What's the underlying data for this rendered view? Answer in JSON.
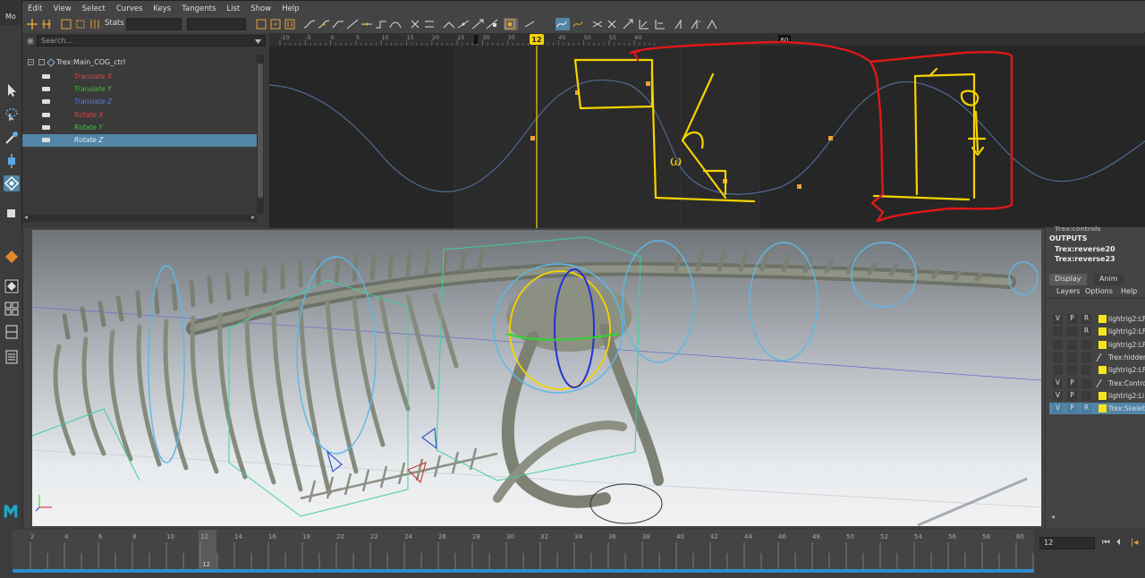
{
  "app": {
    "menu_partial": "Mo"
  },
  "graph_editor": {
    "menu": [
      "Edit",
      "View",
      "Select",
      "Curves",
      "Keys",
      "Tangents",
      "List",
      "Show",
      "Help"
    ],
    "stats_label": "Stats",
    "search_placeholder": "Search...",
    "ruler_ticks": [
      "-10",
      "-5",
      "0",
      "5",
      "10",
      "15",
      "20",
      "25",
      "30",
      "35",
      "40",
      "45",
      "50",
      "55",
      "60"
    ],
    "current_frame": "12",
    "ruler_end_label": "60",
    "outliner": {
      "root": "Trex:Main_COG_ctrl",
      "channels": [
        {
          "label": "Translate X",
          "color": "#e04444"
        },
        {
          "label": "Translate Y",
          "color": "#3fbf3f"
        },
        {
          "label": "Translate Z",
          "color": "#5a7be0"
        },
        {
          "label": "Rotate X",
          "color": "#e04444"
        },
        {
          "label": "Rotate Y",
          "color": "#3fbf3f"
        },
        {
          "label": "Rotate Z",
          "color": "#7d9fe6",
          "selected": true
        }
      ]
    },
    "annotation_text": "ω"
  },
  "channel_box": {
    "truncated_header": "Trex:controls",
    "outputs_label": "OUTPUTS",
    "outputs": [
      "Trex:reverse20",
      "Trex:reverse23"
    ],
    "tabs": [
      "Display",
      "Anim"
    ],
    "submenu": [
      "Layers",
      "Options",
      "Help"
    ],
    "layers": [
      {
        "v": "V",
        "p": "P",
        "r": "R",
        "name": "lightrig2:LF",
        "swatch": true
      },
      {
        "v": "",
        "p": "",
        "r": "R",
        "name": "lightrig2:LF",
        "swatch": true
      },
      {
        "v": "",
        "p": "",
        "r": "",
        "name": "lightrig2:LF",
        "swatch": true
      },
      {
        "v": "",
        "p": "",
        "r": "",
        "name": "Trex:hidden",
        "swatch": false
      },
      {
        "v": "",
        "p": "",
        "r": "",
        "name": "lightrig2:LF",
        "swatch": true
      },
      {
        "v": "V",
        "p": "P",
        "r": "",
        "name": "Trex:Control",
        "swatch": false
      },
      {
        "v": "V",
        "p": "P",
        "r": "",
        "name": "lightrig2:Li",
        "swatch": true
      },
      {
        "v": "V",
        "p": "P",
        "r": "R",
        "name": "Trex:Skeleton",
        "swatch": true,
        "selected": true
      }
    ]
  },
  "timeline": {
    "ticks": [
      "2",
      "4",
      "6",
      "8",
      "10",
      "12",
      "14",
      "16",
      "18",
      "20",
      "22",
      "24",
      "26",
      "28",
      "30",
      "32",
      "34",
      "36",
      "38",
      "40",
      "42",
      "44",
      "46",
      "48",
      "50",
      "52",
      "54",
      "56",
      "58",
      "60"
    ],
    "current_frame": "12",
    "frame_field": "12"
  },
  "colors": {
    "accent_yellow": "#f5d300",
    "selection_blue": "#5285a6",
    "annotation_red": "#e01818"
  }
}
